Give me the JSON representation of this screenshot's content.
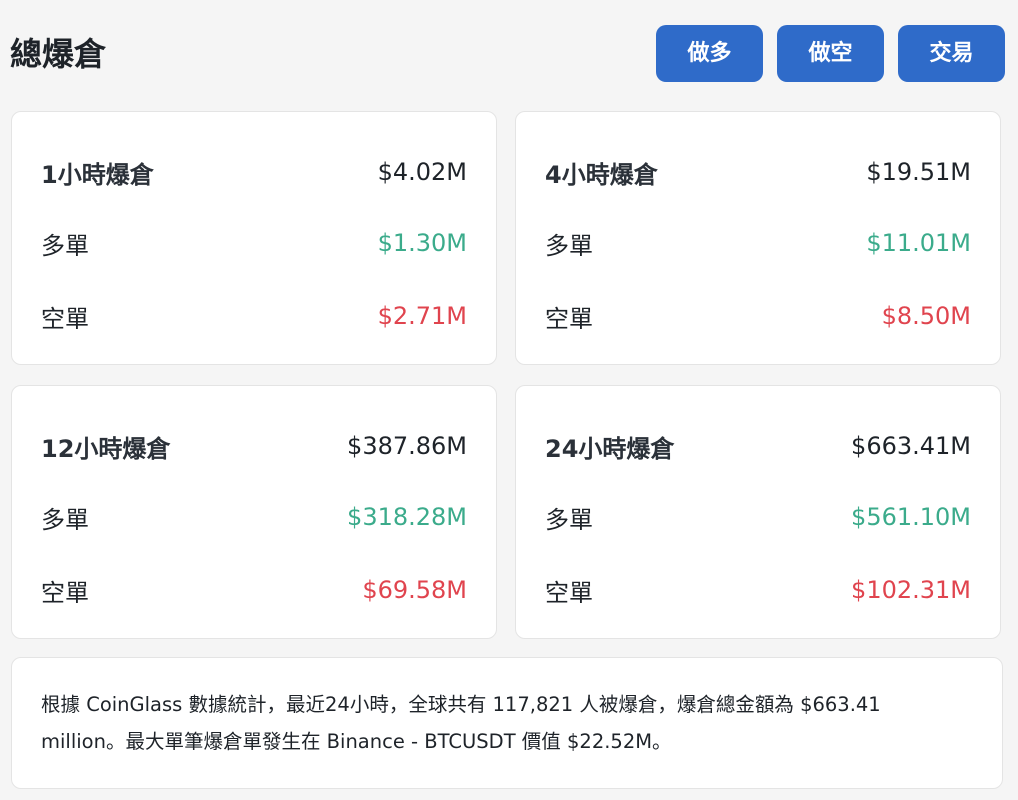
{
  "header": {
    "title": "總爆倉",
    "buttons": {
      "long": "做多",
      "short": "做空",
      "trade": "交易"
    }
  },
  "cards": [
    {
      "title": "1小時爆倉",
      "total": "$4.02M",
      "long_label": "多單",
      "long_value": "$1.30M",
      "short_label": "空單",
      "short_value": "$2.71M"
    },
    {
      "title": "4小時爆倉",
      "total": "$19.51M",
      "long_label": "多單",
      "long_value": "$11.01M",
      "short_label": "空單",
      "short_value": "$8.50M"
    },
    {
      "title": "12小時爆倉",
      "total": "$387.86M",
      "long_label": "多單",
      "long_value": "$318.28M",
      "short_label": "空單",
      "short_value": "$69.58M"
    },
    {
      "title": "24小時爆倉",
      "total": "$663.41M",
      "long_label": "多單",
      "long_value": "$561.10M",
      "short_label": "空單",
      "short_value": "$102.31M"
    }
  ],
  "summary": {
    "text": "根據 CoinGlass 數據統計，最近24小時，全球共有 117,821 人被爆倉，爆倉總金額為 $663.41 million。最大單筆爆倉單發生在 Binance - BTCUSDT 價值 $22.52M。"
  },
  "colors": {
    "button_bg": "#2f6bc9",
    "long": "#3bab8b",
    "short": "#e0444e",
    "text": "#1e2329",
    "page_bg": "#f5f5f5"
  }
}
